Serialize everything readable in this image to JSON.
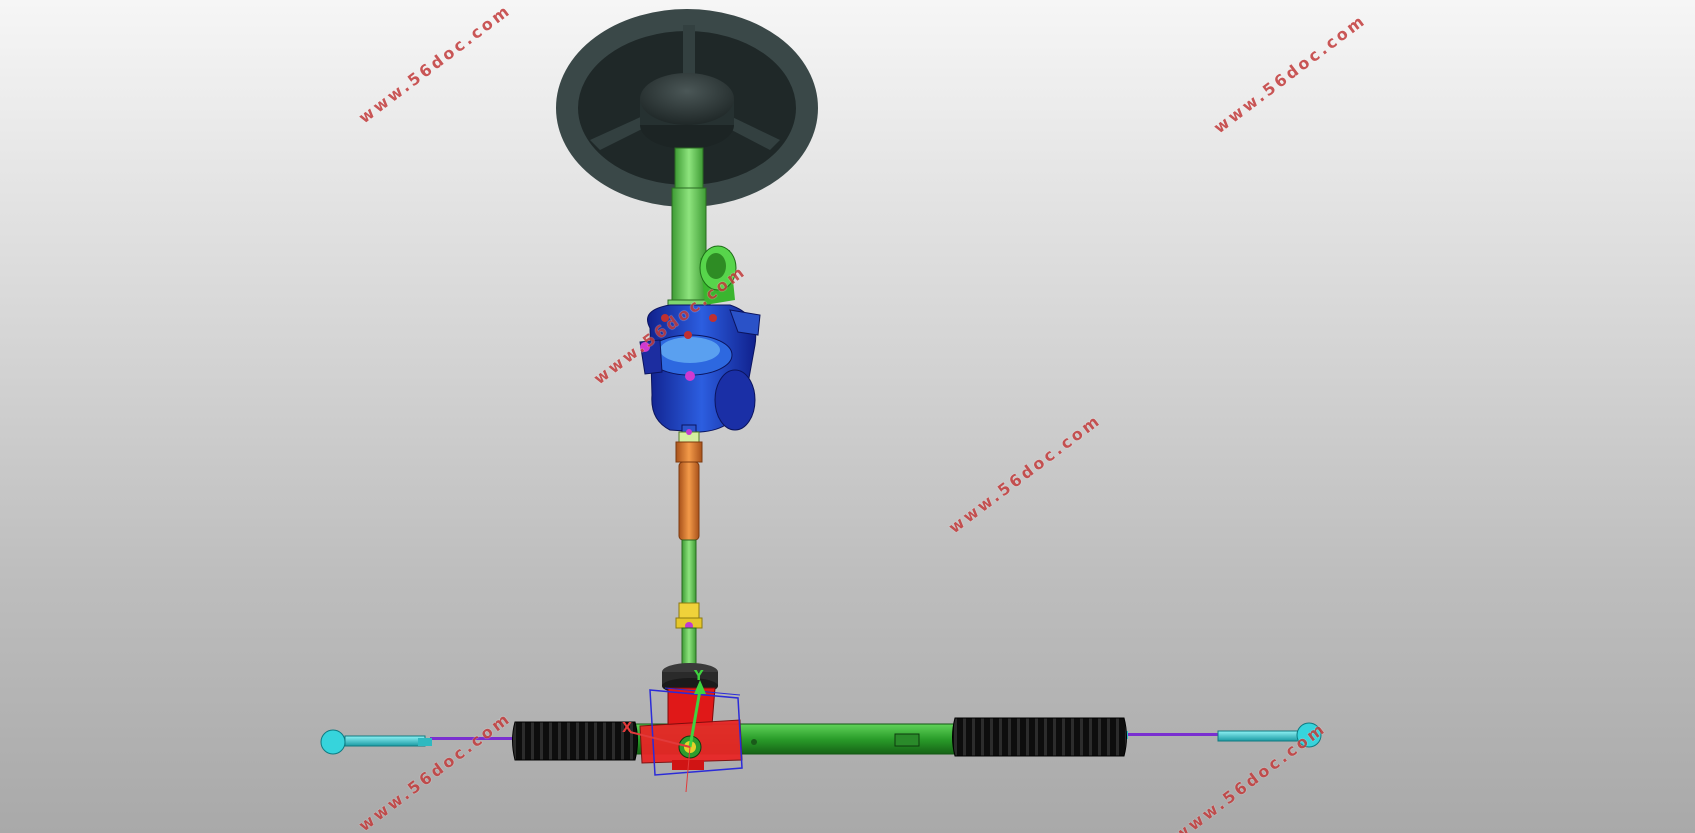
{
  "viewport": {
    "background_top": "#f6f6f6",
    "background_bottom": "#a9a9a9"
  },
  "watermarks": [
    {
      "text": "www.56doc.com"
    },
    {
      "text": "www.56doc.com"
    },
    {
      "text": "www.56doc.com"
    },
    {
      "text": "www.56doc.com"
    },
    {
      "text": "www.56doc.com"
    },
    {
      "text": "www.56doc.com"
    }
  ],
  "triad": {
    "x_label": "X",
    "y_label": "Y",
    "x_color": "#e23a3a",
    "y_color": "#3fd23f"
  },
  "colors": {
    "steering_wheel": "#2f3a3a",
    "column": "#6ad25e",
    "motor_housing": "#1f3fbf",
    "shaft_orange": "#e07a28",
    "rack": "#2fae2f",
    "boot": "#141414",
    "tie_rod": "#3fd2d8",
    "pinion_housing": "#e02020"
  }
}
